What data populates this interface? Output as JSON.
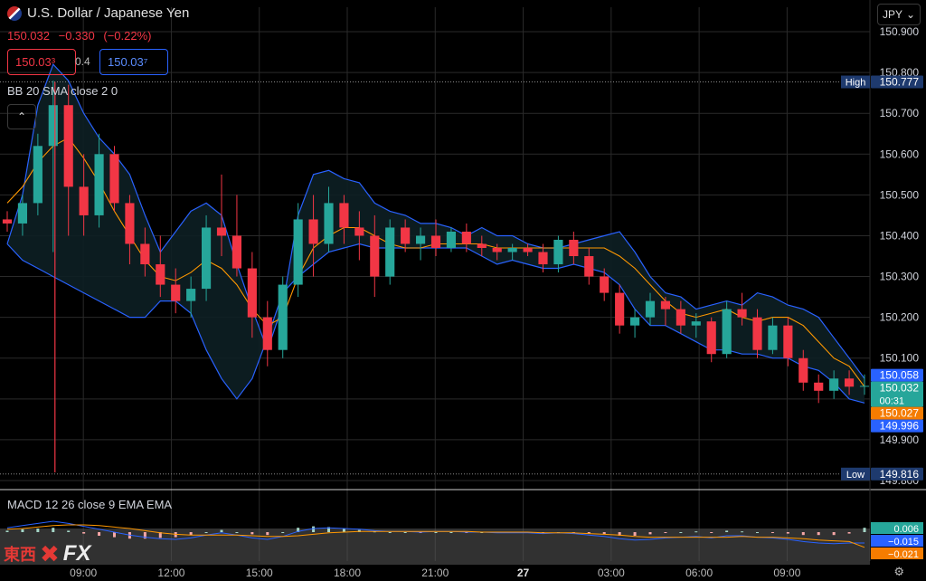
{
  "header": {
    "title": "U.S. Dollar / Japanese Yen",
    "last": "150.032",
    "change": "−0.330",
    "change_pct": "(−0.22%)",
    "sell_price": "150.03³",
    "spread": "0.4",
    "buy_price": "150.03⁷",
    "indicator_label": "BB 20 SMA close 2 0",
    "currency": "JPY",
    "collapse_icon": "chevron-up-icon"
  },
  "macd": {
    "label": "MACD 12 26 close 9 EMA EMA"
  },
  "branding": {
    "cn": "東西",
    "fx": "FX"
  },
  "colors": {
    "up": "#26a69a",
    "down": "#f23645",
    "bb_band": "#2962ff",
    "bb_basis": "#ff9800",
    "grid": "#2a2a2a",
    "spike": "#f23645"
  },
  "chart_data": {
    "type": "candlestick",
    "ylim": [
      149.78,
      150.96
    ],
    "yticks": [
      "150.900",
      "150.800",
      "150.700",
      "150.600",
      "150.500",
      "150.400",
      "150.300",
      "150.200",
      "150.100",
      "150.000",
      "149.900",
      "149.800"
    ],
    "xtick_labels": [
      "09:00",
      "12:00",
      "15:00",
      "18:00",
      "21:00",
      "27",
      "03:00",
      "06:00",
      "09:00"
    ],
    "bollinger": {
      "upper": [
        150.38,
        150.5,
        150.72,
        150.82,
        150.78,
        150.7,
        150.64,
        150.6,
        150.55,
        150.45,
        150.36,
        150.41,
        150.46,
        150.48,
        150.45,
        150.33,
        150.22,
        150.12,
        150.23,
        150.45,
        150.55,
        150.56,
        150.54,
        150.53,
        150.48,
        150.46,
        150.45,
        150.43,
        150.43,
        150.42,
        150.4,
        150.42,
        150.4,
        150.4,
        150.38,
        150.37,
        150.37,
        150.38,
        150.39,
        150.4,
        150.41,
        150.36,
        150.3,
        150.26,
        150.25,
        150.22,
        150.23,
        150.24,
        150.23,
        150.26,
        150.25,
        150.23,
        150.22,
        150.2,
        150.15,
        150.1,
        150.05
      ],
      "basis": [
        150.48,
        150.52,
        150.58,
        150.62,
        150.64,
        150.59,
        150.53,
        150.46,
        150.4,
        150.34,
        150.3,
        150.29,
        150.31,
        150.34,
        150.32,
        150.28,
        150.22,
        150.18,
        150.2,
        150.3,
        150.37,
        150.4,
        150.42,
        150.42,
        150.4,
        150.38,
        150.37,
        150.37,
        150.38,
        150.38,
        150.38,
        150.38,
        150.37,
        150.37,
        150.37,
        150.37,
        150.37,
        150.37,
        150.37,
        150.37,
        150.35,
        150.32,
        150.28,
        150.24,
        150.21,
        150.2,
        150.21,
        150.22,
        150.2,
        150.19,
        150.2,
        150.2,
        150.18,
        150.14,
        150.1,
        150.08,
        150.03
      ],
      "lower": [
        150.38,
        150.34,
        150.32,
        150.3,
        150.28,
        150.26,
        150.24,
        150.22,
        150.2,
        150.2,
        150.24,
        150.24,
        150.21,
        150.12,
        150.05,
        150.0,
        150.05,
        150.15,
        150.26,
        150.3,
        150.33,
        150.36,
        150.37,
        150.38,
        150.37,
        150.37,
        150.37,
        150.37,
        150.37,
        150.37,
        150.37,
        150.35,
        150.33,
        150.34,
        150.33,
        150.32,
        150.32,
        150.33,
        150.32,
        150.31,
        150.28,
        150.22,
        150.18,
        150.18,
        150.16,
        150.14,
        150.12,
        150.12,
        150.11,
        150.11,
        150.1,
        150.1,
        150.08,
        150.07,
        150.04,
        150.0,
        149.99
      ]
    },
    "candles": [
      [
        150.44,
        150.46,
        150.41,
        150.43
      ],
      [
        150.43,
        150.5,
        150.4,
        150.48
      ],
      [
        150.48,
        150.65,
        150.45,
        150.62
      ],
      [
        150.62,
        150.78,
        150.36,
        150.72
      ],
      [
        150.72,
        150.77,
        150.4,
        150.52
      ],
      [
        150.52,
        150.6,
        150.4,
        150.45
      ],
      [
        150.45,
        150.65,
        150.42,
        150.6
      ],
      [
        150.6,
        150.62,
        150.46,
        150.48
      ],
      [
        150.48,
        150.5,
        150.33,
        150.38
      ],
      [
        150.38,
        150.42,
        150.3,
        150.33
      ],
      [
        150.33,
        150.4,
        150.25,
        150.28
      ],
      [
        150.28,
        150.32,
        150.21,
        150.24
      ],
      [
        150.24,
        150.3,
        150.2,
        150.27
      ],
      [
        150.27,
        150.45,
        150.24,
        150.42
      ],
      [
        150.42,
        150.55,
        150.35,
        150.4
      ],
      [
        150.4,
        150.5,
        150.3,
        150.32
      ],
      [
        150.32,
        150.36,
        150.15,
        150.2
      ],
      [
        150.2,
        150.24,
        150.08,
        150.12
      ],
      [
        150.12,
        150.3,
        150.1,
        150.28
      ],
      [
        150.28,
        150.48,
        150.25,
        150.44
      ],
      [
        150.44,
        150.5,
        150.3,
        150.38
      ],
      [
        150.38,
        150.52,
        150.36,
        150.48
      ],
      [
        150.48,
        150.5,
        150.38,
        150.42
      ],
      [
        150.42,
        150.46,
        150.34,
        150.4
      ],
      [
        150.4,
        150.45,
        150.25,
        150.3
      ],
      [
        150.3,
        150.44,
        150.28,
        150.42
      ],
      [
        150.42,
        150.44,
        150.36,
        150.38
      ],
      [
        150.38,
        150.42,
        150.34,
        150.4
      ],
      [
        150.4,
        150.44,
        150.35,
        150.37
      ],
      [
        150.37,
        150.42,
        150.36,
        150.41
      ],
      [
        150.41,
        150.43,
        150.36,
        150.38
      ],
      [
        150.38,
        150.4,
        150.35,
        150.37
      ],
      [
        150.37,
        150.38,
        150.34,
        150.36
      ],
      [
        150.36,
        150.38,
        150.34,
        150.37
      ],
      [
        150.37,
        150.38,
        150.35,
        150.36
      ],
      [
        150.36,
        150.38,
        150.31,
        150.33
      ],
      [
        150.33,
        150.4,
        150.31,
        150.39
      ],
      [
        150.39,
        150.41,
        150.33,
        150.35
      ],
      [
        150.35,
        150.37,
        150.28,
        150.3
      ],
      [
        150.3,
        150.32,
        150.24,
        150.26
      ],
      [
        150.26,
        150.28,
        150.16,
        150.18
      ],
      [
        150.18,
        150.22,
        150.15,
        150.2
      ],
      [
        150.2,
        150.26,
        150.18,
        150.24
      ],
      [
        150.24,
        150.25,
        150.18,
        150.22
      ],
      [
        150.22,
        150.24,
        150.16,
        150.18
      ],
      [
        150.18,
        150.21,
        150.15,
        150.19
      ],
      [
        150.19,
        150.2,
        150.09,
        150.11
      ],
      [
        150.11,
        150.24,
        150.1,
        150.22
      ],
      [
        150.22,
        150.26,
        150.18,
        150.2
      ],
      [
        150.2,
        150.22,
        150.1,
        150.12
      ],
      [
        150.12,
        150.2,
        150.11,
        150.18
      ],
      [
        150.18,
        150.2,
        150.08,
        150.1
      ],
      [
        150.1,
        150.12,
        150.02,
        150.04
      ],
      [
        150.04,
        150.06,
        149.99,
        150.02
      ],
      [
        150.02,
        150.07,
        150.0,
        150.05
      ],
      [
        150.05,
        150.07,
        150.01,
        150.03
      ],
      [
        150.03,
        150.06,
        150.01,
        150.032
      ]
    ],
    "spike": {
      "index": 3,
      "high": 150.777,
      "low": 149.82
    },
    "reference_lines": {
      "high": 150.777,
      "low": 149.816
    },
    "price_labels": [
      {
        "value": 150.777,
        "text": "150.777",
        "tag": "High",
        "color": "#1e3a6e"
      },
      {
        "value": 150.058,
        "text": "150.058",
        "color": "#2962ff"
      },
      {
        "value": 150.032,
        "text": "150.032",
        "color": "#26a69a",
        "timer": "00:31"
      },
      {
        "value": 150.027,
        "text": "150.027",
        "color": "#f57c00"
      },
      {
        "value": 149.996,
        "text": "149.996",
        "color": "#2962ff"
      },
      {
        "value": 149.816,
        "text": "149.816",
        "tag": "Low",
        "color": "#1e3a6e"
      }
    ],
    "macd_panel": {
      "ylim": [
        -0.03,
        0.02
      ],
      "labels": [
        {
          "text": "0.006",
          "color": "#26a69a"
        },
        {
          "text": "−0.015",
          "color": "#2962ff"
        },
        {
          "text": "−0.021",
          "color": "#f57c00"
        }
      ],
      "macd": [
        0.006,
        0.009,
        0.012,
        0.015,
        0.012,
        0.008,
        0.004,
        0.0,
        -0.004,
        -0.007,
        -0.009,
        -0.01,
        -0.008,
        -0.004,
        -0.001,
        -0.004,
        -0.008,
        -0.01,
        -0.006,
        0.001,
        0.005,
        0.006,
        0.005,
        0.004,
        0.002,
        0.001,
        0.001,
        0.0,
        0.001,
        0.001,
        0.0,
        0.0,
        -0.001,
        -0.001,
        -0.001,
        -0.002,
        -0.001,
        -0.002,
        -0.004,
        -0.006,
        -0.009,
        -0.011,
        -0.01,
        -0.008,
        -0.007,
        -0.006,
        -0.008,
        -0.005,
        -0.005,
        -0.007,
        -0.008,
        -0.01,
        -0.013,
        -0.015,
        -0.016,
        -0.015,
        -0.015
      ],
      "signal": [
        0.004,
        0.005,
        0.007,
        0.009,
        0.01,
        0.01,
        0.009,
        0.007,
        0.005,
        0.002,
        -0.001,
        -0.003,
        -0.004,
        -0.004,
        -0.004,
        -0.004,
        -0.005,
        -0.006,
        -0.006,
        -0.005,
        -0.003,
        -0.001,
        0.0,
        0.001,
        0.001,
        0.001,
        0.001,
        0.001,
        0.001,
        0.001,
        0.001,
        0.0,
        0.0,
        0.0,
        0.0,
        -0.001,
        -0.001,
        -0.001,
        -0.002,
        -0.003,
        -0.004,
        -0.006,
        -0.007,
        -0.007,
        -0.007,
        -0.007,
        -0.007,
        -0.007,
        -0.006,
        -0.007,
        -0.007,
        -0.008,
        -0.009,
        -0.011,
        -0.012,
        -0.013,
        -0.021
      ]
    }
  }
}
